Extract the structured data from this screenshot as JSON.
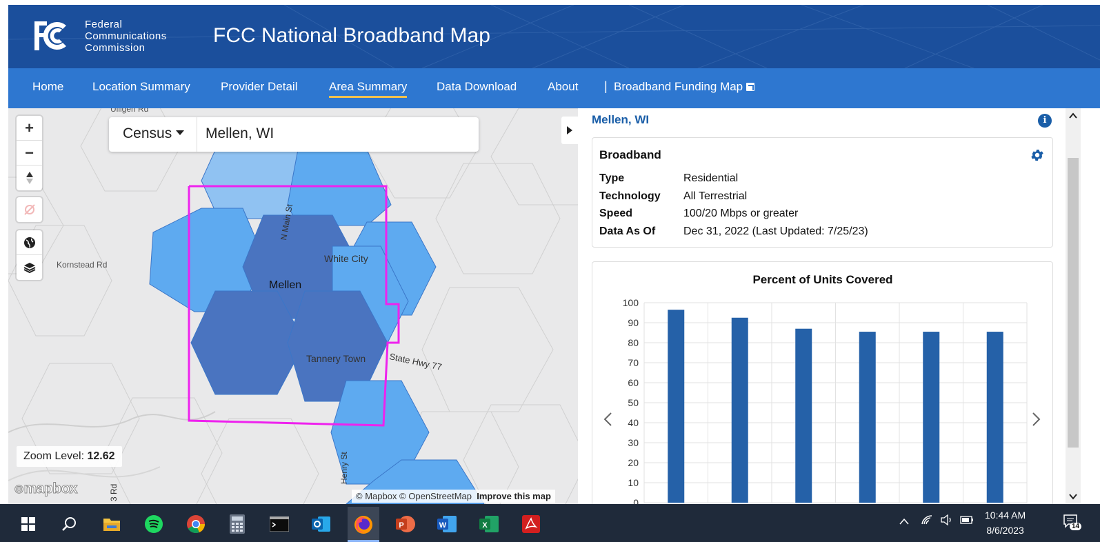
{
  "header": {
    "agency_line1": "Federal",
    "agency_line2": "Communications",
    "agency_line3": "Commission",
    "site_title": "FCC National Broadband Map"
  },
  "nav": {
    "items": [
      {
        "label": "Home",
        "active": false
      },
      {
        "label": "Location Summary",
        "active": false
      },
      {
        "label": "Provider Detail",
        "active": false
      },
      {
        "label": "Area Summary",
        "active": true
      },
      {
        "label": "Data Download",
        "active": false
      },
      {
        "label": "About",
        "active": false
      }
    ],
    "separator": "|",
    "funding_link": "Broadband Funding Map"
  },
  "map": {
    "search": {
      "type_label": "Census",
      "value": "Mellen, WI"
    },
    "labels": {
      "kornstead": "Kornstead Rd",
      "main_st": "N Main St",
      "white_city": "White City",
      "mellen": "Mellen",
      "tannery": "Tannery Town",
      "hwy77": "State Hwy 77",
      "henry_st": "Henry St",
      "road_3": "3 Rd",
      "top_rd": "Ulligen Rd"
    },
    "zoom_label": "Zoom Level:",
    "zoom_value": "12.62",
    "logo": "mapbox",
    "attribution": "© Mapbox © OpenStreetMap",
    "improve": "Improve this map",
    "colors": {
      "boundary": "#ee22ee",
      "hex_light": "#90c2f2",
      "hex_mid": "#5eaaf0",
      "hex_dark": "#4a74c0"
    }
  },
  "panel": {
    "area_title": "Mellen, WI",
    "broadband": {
      "title": "Broadband",
      "rows": [
        {
          "key": "Type",
          "value": "Residential"
        },
        {
          "key": "Technology",
          "value": "All Terrestrial"
        },
        {
          "key": "Speed",
          "value": "100/20 Mbps or greater"
        },
        {
          "key": "Data As Of",
          "value": "Dec 31, 2022 (Last Updated: 7/25/23)"
        }
      ]
    }
  },
  "chart_data": {
    "type": "bar",
    "title": "Percent of Units Covered",
    "xlabel": "",
    "ylabel": "",
    "ylim": [
      0,
      100
    ],
    "yticks": [
      0,
      10,
      20,
      30,
      40,
      50,
      60,
      70,
      80,
      90,
      100
    ],
    "values": [
      96.5,
      92.5,
      87,
      85.5,
      85.5,
      85.5
    ],
    "bar_color": "#2561a8",
    "grid": true
  },
  "taskbar": {
    "time": "10:44 AM",
    "date": "8/6/2023",
    "notification_count": "14",
    "icons": [
      "windows-start-icon",
      "search-icon",
      "file-explorer-icon",
      "spotify-icon",
      "chrome-icon",
      "calculator-icon",
      "terminal-icon",
      "outlook-icon",
      "firefox-icon",
      "powerpoint-icon",
      "word-icon",
      "excel-icon",
      "acrobat-icon"
    ]
  }
}
